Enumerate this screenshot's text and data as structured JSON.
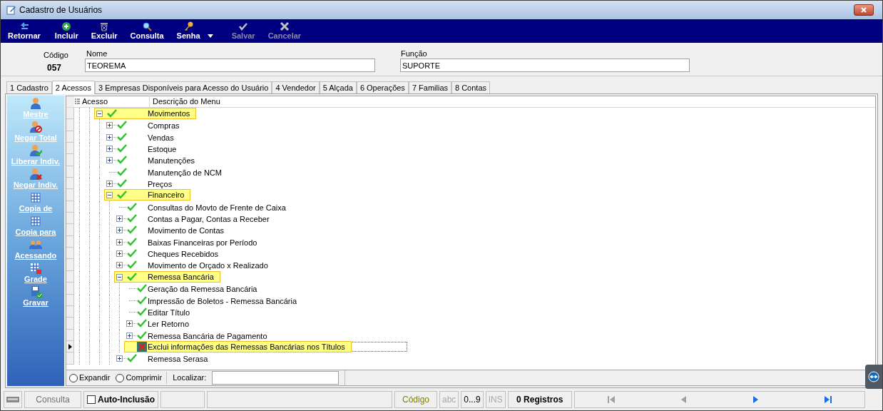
{
  "window": {
    "title": "Cadastro de Usuários"
  },
  "toolbar": [
    {
      "label": "Retornar",
      "disabled": false,
      "dropdown": false
    },
    {
      "label": "Incluir",
      "disabled": false,
      "dropdown": false
    },
    {
      "label": "Excluir",
      "disabled": false,
      "dropdown": false
    },
    {
      "label": "Consulta",
      "disabled": false,
      "dropdown": false
    },
    {
      "label": "Senha",
      "disabled": false,
      "dropdown": true
    },
    {
      "label": "Salvar",
      "disabled": true,
      "dropdown": false
    },
    {
      "label": "Cancelar",
      "disabled": true,
      "dropdown": false
    }
  ],
  "form": {
    "codigo": {
      "label": "Código",
      "value": "057"
    },
    "nome": {
      "label": "Nome",
      "value": "TEOREMA"
    },
    "funcao": {
      "label": "Função",
      "value": "SUPORTE"
    }
  },
  "tabs": [
    {
      "label": "1 Cadastro",
      "selected": false
    },
    {
      "label": "2 Acessos",
      "selected": true
    },
    {
      "label": "3 Empresas Disponíveis para Acesso do Usuário",
      "selected": false
    },
    {
      "label": "4 Vendedor",
      "selected": false
    },
    {
      "label": "5 Alçada",
      "selected": false
    },
    {
      "label": "6 Operações",
      "selected": false
    },
    {
      "label": "7 Familias",
      "selected": false
    },
    {
      "label": "8 Contas",
      "selected": false
    }
  ],
  "sidebar": [
    {
      "label": "Mestre"
    },
    {
      "label": "Negar Total"
    },
    {
      "label": "Liberar Indiv."
    },
    {
      "label": "Negar Indiv."
    },
    {
      "label": "Copia de"
    },
    {
      "label": "Copia para"
    },
    {
      "label": "Acessando"
    },
    {
      "label": "Grade"
    },
    {
      "label": "Gravar"
    }
  ],
  "tree": {
    "columns": [
      "Acesso",
      "Descrição do Menu"
    ],
    "rows": [
      {
        "label": "Movimentos",
        "kind": "group",
        "expanded": true,
        "allowed": true,
        "highlighted": true,
        "selected": false,
        "children": [
          {
            "label": "Compras",
            "kind": "group",
            "expanded": false,
            "allowed": true,
            "highlighted": false,
            "selected": false
          },
          {
            "label": "Vendas",
            "kind": "group",
            "expanded": false,
            "allowed": true,
            "highlighted": false,
            "selected": false
          },
          {
            "label": "Estoque",
            "kind": "group",
            "expanded": false,
            "allowed": true,
            "highlighted": false,
            "selected": false
          },
          {
            "label": "Manutenções",
            "kind": "group",
            "expanded": false,
            "allowed": true,
            "highlighted": false,
            "selected": false
          },
          {
            "label": "Manutenção de NCM",
            "kind": "leaf",
            "allowed": true,
            "highlighted": false,
            "selected": false
          },
          {
            "label": "Preços",
            "kind": "group",
            "expanded": false,
            "allowed": true,
            "highlighted": false,
            "selected": false
          },
          {
            "label": "Financeiro",
            "kind": "group",
            "expanded": true,
            "allowed": true,
            "highlighted": true,
            "selected": false,
            "children": [
              {
                "label": "Consultas do Movto de Frente de Caixa",
                "kind": "leaf",
                "allowed": true,
                "highlighted": false,
                "selected": false
              },
              {
                "label": "Contas a Pagar, Contas a Receber",
                "kind": "group",
                "expanded": false,
                "allowed": true,
                "highlighted": false,
                "selected": false
              },
              {
                "label": "Movimento de Contas",
                "kind": "group",
                "expanded": false,
                "allowed": true,
                "highlighted": false,
                "selected": false
              },
              {
                "label": "Baixas Financeiras por Período",
                "kind": "group",
                "expanded": false,
                "allowed": true,
                "highlighted": false,
                "selected": false
              },
              {
                "label": "Cheques Recebidos",
                "kind": "group",
                "expanded": false,
                "allowed": true,
                "highlighted": false,
                "selected": false
              },
              {
                "label": "Movimento de Orçado x Realizado",
                "kind": "group",
                "expanded": false,
                "allowed": true,
                "highlighted": false,
                "selected": false
              },
              {
                "label": "Remessa Bancária",
                "kind": "group",
                "expanded": true,
                "allowed": true,
                "highlighted": true,
                "selected": false,
                "children": [
                  {
                    "label": "Geração da Remessa Bancária",
                    "kind": "leaf",
                    "allowed": true,
                    "highlighted": false,
                    "selected": false
                  },
                  {
                    "label": "Impressão de Boletos - Remessa Bancária",
                    "kind": "leaf",
                    "allowed": true,
                    "highlighted": false,
                    "selected": false
                  },
                  {
                    "label": "Editar Título",
                    "kind": "leaf",
                    "allowed": true,
                    "highlighted": false,
                    "selected": false
                  },
                  {
                    "label": "Ler Retorno",
                    "kind": "group",
                    "expanded": false,
                    "allowed": true,
                    "highlighted": false,
                    "selected": false
                  },
                  {
                    "label": "Remessa Bancária de Pagamento",
                    "kind": "group",
                    "expanded": false,
                    "allowed": true,
                    "highlighted": false,
                    "selected": false
                  },
                  {
                    "label": "Exclui informações das Remessas Bancárias nos Títulos",
                    "kind": "leaf",
                    "allowed": false,
                    "highlighted": true,
                    "selected": true
                  }
                ]
              },
              {
                "label": "Remessa Serasa",
                "kind": "group",
                "expanded": false,
                "allowed": true,
                "highlighted": false,
                "selected": false
              }
            ]
          }
        ]
      }
    ]
  },
  "tree_footer": {
    "options": [
      {
        "label": "Expandir",
        "selected": false
      },
      {
        "label": "Comprimir",
        "selected": false
      }
    ],
    "search_label": "Localizar:"
  },
  "status_bar": {
    "mode": "Consulta",
    "auto_inclusao": {
      "label": "Auto-Inclusão",
      "checked": false
    },
    "field": "Código",
    "indicators": [
      {
        "label": "abc",
        "active": false
      },
      {
        "label": "0...9",
        "active": true
      },
      {
        "label": "INS",
        "active": false
      }
    ],
    "records": "0 Registros",
    "nav": [
      {
        "disabled": true
      },
      {
        "disabled": true
      },
      {
        "disabled": false
      },
      {
        "disabled": false
      }
    ]
  }
}
